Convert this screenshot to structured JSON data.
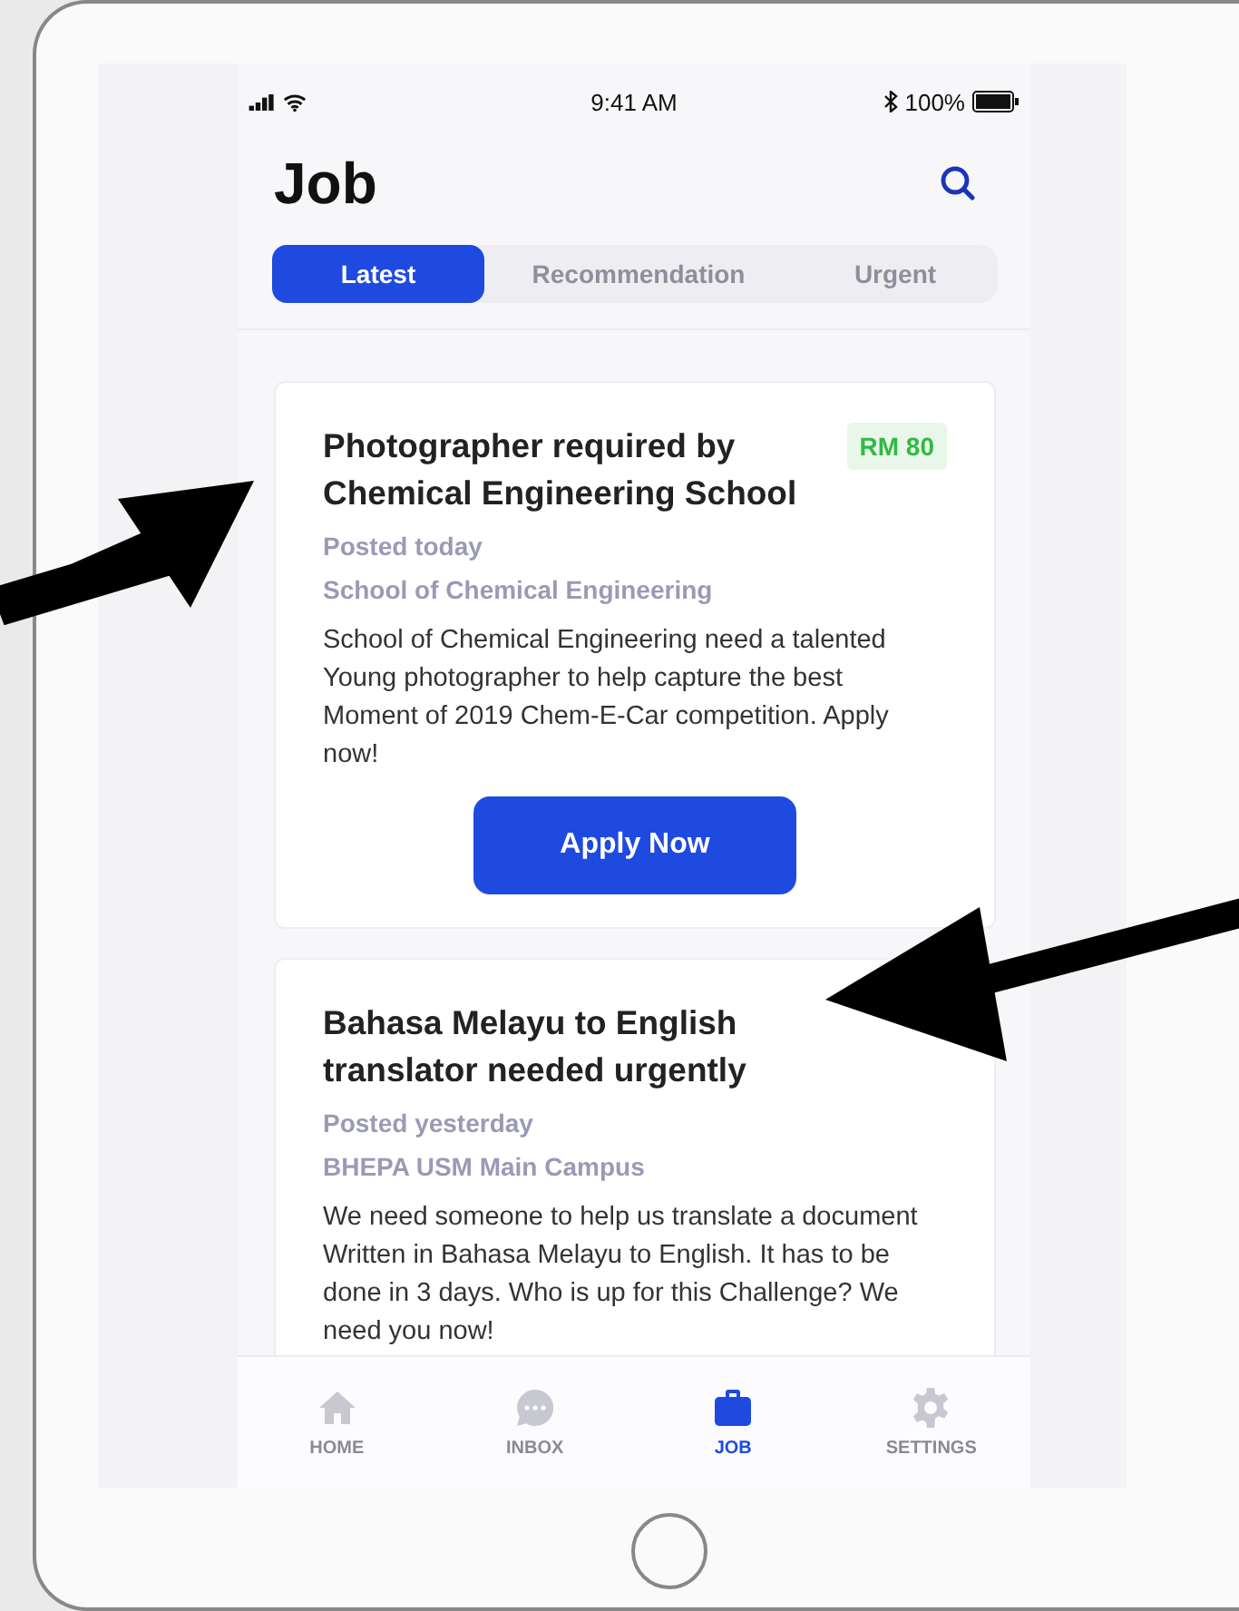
{
  "status_bar": {
    "time": "9:41 AM",
    "battery": "100%"
  },
  "header": {
    "title": "Job"
  },
  "tabs": [
    {
      "label": "Latest",
      "selected": true
    },
    {
      "label": "Recommendation",
      "selected": false
    },
    {
      "label": "Urgent",
      "selected": false
    }
  ],
  "jobs": [
    {
      "title": "Photographer required by Chemical Engineering School",
      "pay": "RM 80",
      "posted": "Posted today",
      "organizer": "School of Chemical Engineering",
      "description": "School of Chemical Engineering need a talented Young photographer to help capture the best Moment of 2019 Chem-E-Car competition. Apply now!",
      "button": "Apply Now"
    },
    {
      "title": "Bahasa Melayu to English translator needed urgently",
      "posted": "Posted yesterday",
      "organizer": "BHEPA USM Main Campus",
      "description": "We need someone to help us translate a document Written in Bahasa Melayu to English. It has to be done in 3 days. Who is up for this Challenge? We need you now!"
    }
  ],
  "nav": [
    {
      "label": "HOME",
      "kind": "home",
      "selected": false
    },
    {
      "label": "INBOX",
      "kind": "inbox",
      "selected": false
    },
    {
      "label": "JOB",
      "kind": "job",
      "selected": true
    },
    {
      "label": "SETTINGS",
      "kind": "settings",
      "selected": false
    }
  ]
}
